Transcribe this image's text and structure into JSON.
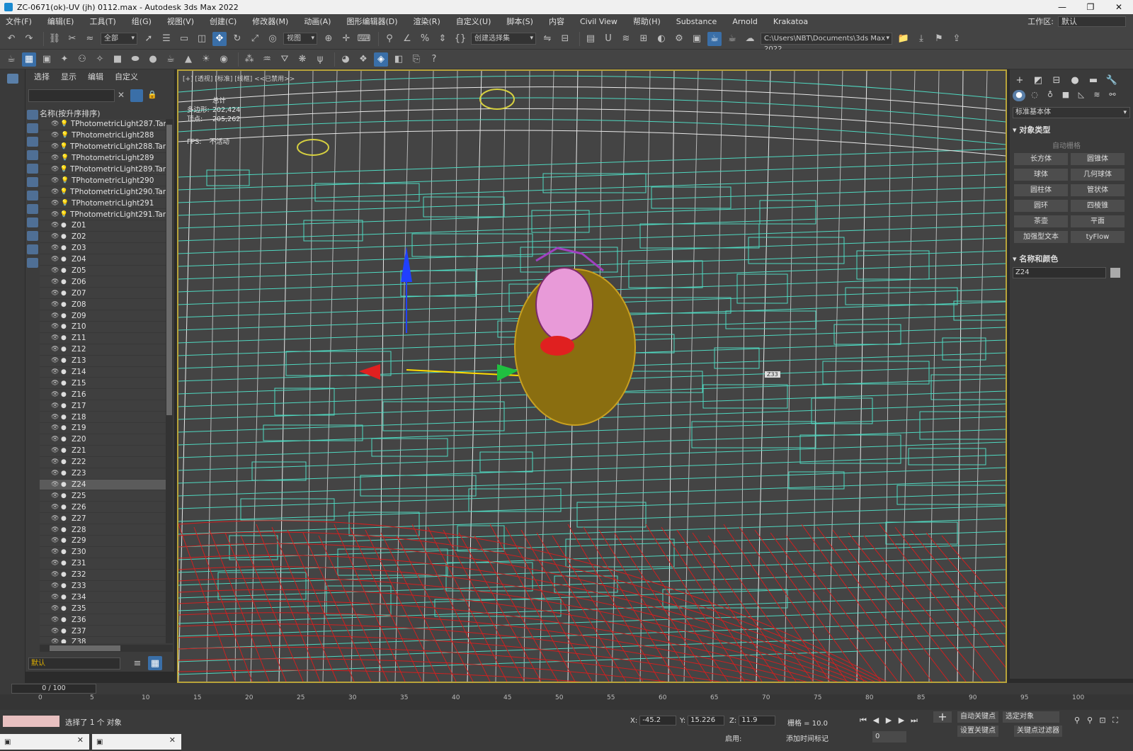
{
  "window": {
    "title": "ZC-0671(ok)-UV (jh) 0112.max - Autodesk 3ds Max 2022",
    "controls": [
      "—",
      "❐",
      "✕"
    ]
  },
  "menu": {
    "items": [
      "文件(F)",
      "编辑(E)",
      "工具(T)",
      "组(G)",
      "视图(V)",
      "创建(C)",
      "修改器(M)",
      "动画(A)",
      "图形编辑器(D)",
      "渲染(R)",
      "自定义(U)",
      "脚本(S)",
      "内容",
      "Civil View",
      "帮助(H)",
      "Substance",
      "Arnold",
      "Krakatoa"
    ],
    "workspace_label": "工作区:",
    "workspace_value": "默认"
  },
  "toolbar": {
    "selection_filter": "全部",
    "ref_coord": "视图",
    "named_selection": "创建选择集",
    "project_path": "C:\\Users\\NBT\\Documents\\3ds Max 2022"
  },
  "scene_explorer": {
    "tabs": [
      "选择",
      "显示",
      "编辑",
      "自定义"
    ],
    "column_header": "名称(按升序排序)",
    "rows": [
      "TPhotometricLight287.Targ",
      "TPhotometricLight288",
      "TPhotometricLight288.Targe",
      "TPhotometricLight289",
      "TPhotometricLight289.Targe",
      "TPhotometricLight290",
      "TPhotometricLight290.Targe",
      "TPhotometricLight291",
      "TPhotometricLight291.Targe",
      "Z01",
      "Z02",
      "Z03",
      "Z04",
      "Z05",
      "Z06",
      "Z07",
      "Z08",
      "Z09",
      "Z10",
      "Z11",
      "Z12",
      "Z13",
      "Z14",
      "Z15",
      "Z16",
      "Z17",
      "Z18",
      "Z19",
      "Z20",
      "Z21",
      "Z22",
      "Z23",
      "Z24",
      "Z25",
      "Z26",
      "Z27",
      "Z28",
      "Z29",
      "Z30",
      "Z31",
      "Z32",
      "Z33",
      "Z34",
      "Z35",
      "Z36",
      "Z37",
      "Z38"
    ],
    "selected_row": "Z24",
    "layer": "默认"
  },
  "viewport": {
    "label": "[+] [透视] [标准] [线框] <<已禁用>>",
    "stats_title": "总计",
    "polys_label": "多边形:",
    "polys_value": "202,424",
    "verts_label": "顶点:",
    "verts_value": "205,262",
    "fps_label": "FPS:",
    "fps_value": "不活动",
    "tag": "Z33"
  },
  "command_panel": {
    "category": "标准基本体",
    "object_type_title": "对象类型",
    "autogrid": "自动栅格",
    "buttons": [
      "长方体",
      "圆锥体",
      "球体",
      "几何球体",
      "圆柱体",
      "管状体",
      "圆环",
      "四棱锥",
      "茶壶",
      "平面",
      "加强型文本",
      "tyFlow"
    ],
    "name_color_title": "名称和颜色",
    "object_name": "Z24"
  },
  "timeline": {
    "frame": "0 / 100",
    "ticks": [
      "0",
      "5",
      "10",
      "15",
      "20",
      "25",
      "30",
      "35",
      "40",
      "45",
      "50",
      "55",
      "60",
      "65",
      "70",
      "75",
      "80",
      "85",
      "90",
      "95",
      "100"
    ]
  },
  "status": {
    "selected": "选择了 1 个 对象",
    "x_label": "X:",
    "x_value": "-45.2",
    "y_label": "Y:",
    "y_value": "15.226",
    "z_label": "Z:",
    "z_value": "11.9",
    "grid": "栅格 = 10.0",
    "enable": "启用:",
    "add_time_tag": "添加时间标记",
    "auto_key": "自动关键点",
    "set_key": "设置关键点",
    "selected_object": "选定对象",
    "key_filters": "关键点过滤器",
    "current_frame": "0"
  },
  "colors": {
    "wire_cyan": "#4fd8c0",
    "wire_white": "#e8e8e8",
    "wire_red": "#d02020",
    "emblem_gold": "#c9a020",
    "emblem_pink": "#e89ad8",
    "viewport_border": "#b8a33a",
    "accent_blue": "#3a6fa8"
  }
}
